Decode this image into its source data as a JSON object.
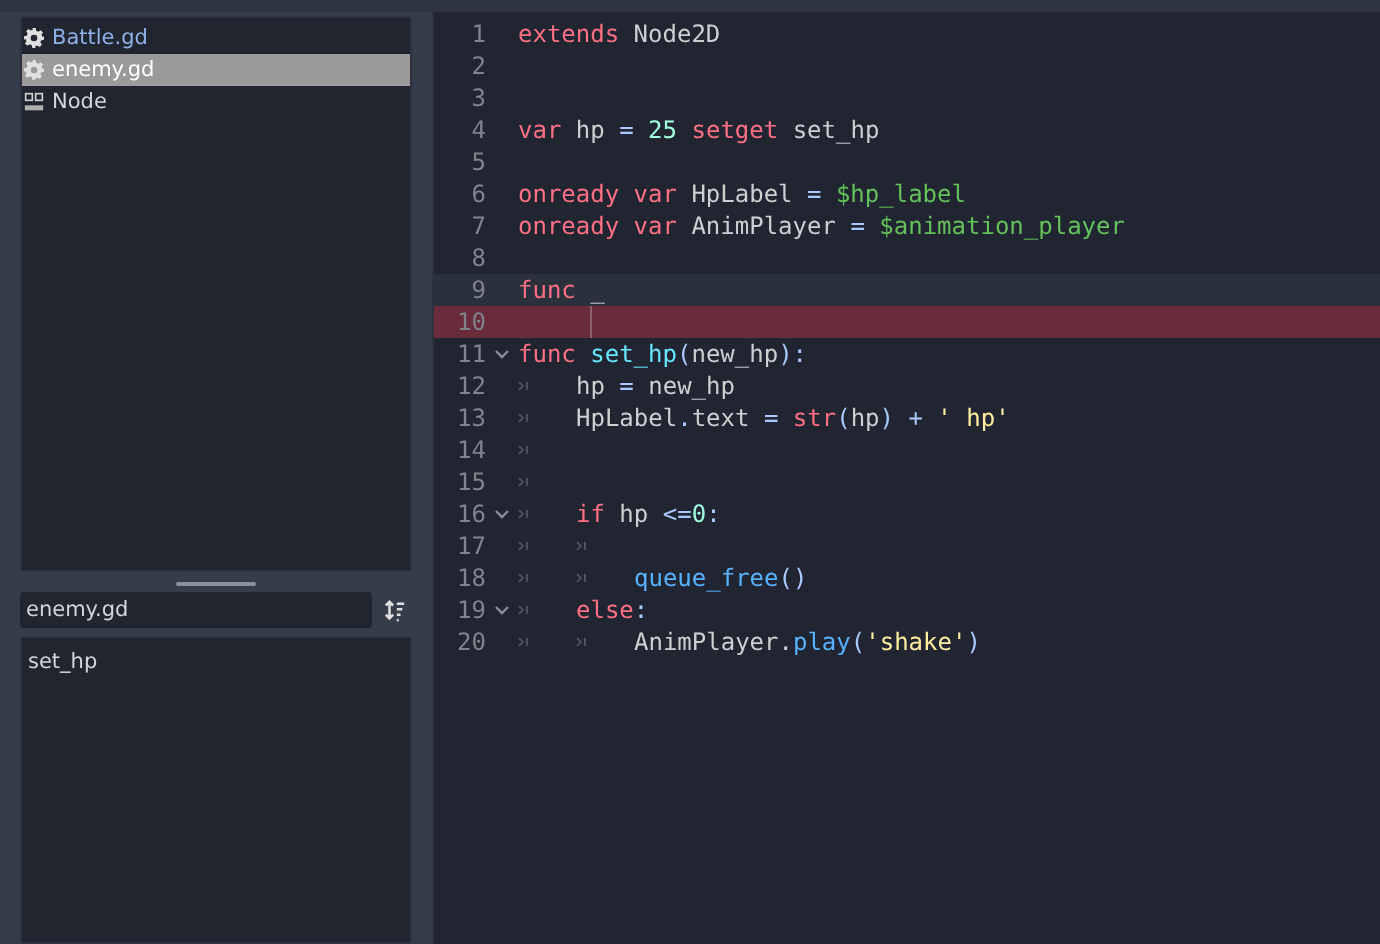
{
  "scripts": [
    {
      "label": "Battle.gd",
      "kind": "script",
      "selected": false,
      "color": "#8fb0e8"
    },
    {
      "label": "enemy.gd",
      "kind": "script",
      "selected": true,
      "color": "#ffffff"
    },
    {
      "label": "Node",
      "kind": "doc",
      "selected": false,
      "color": "#d4d6da"
    }
  ],
  "filter": {
    "value": "enemy.gd"
  },
  "methods": [
    {
      "label": "set_hp",
      "selected": false
    }
  ],
  "lines": [
    {
      "number": "1",
      "kind": "normal",
      "fold": false,
      "cursor": false,
      "tokens": [
        {
          "kind": "keyword",
          "text": "extends"
        },
        {
          "kind": "plain",
          "text": " Node2D"
        }
      ]
    },
    {
      "number": "2",
      "kind": "normal",
      "fold": false,
      "cursor": false
    },
    {
      "number": "3",
      "kind": "normal",
      "fold": false,
      "cursor": false
    },
    {
      "number": "4",
      "kind": "normal",
      "fold": false,
      "cursor": false,
      "tokens": [
        {
          "kind": "keyword",
          "text": "var"
        },
        {
          "kind": "plain",
          "text": " hp"
        },
        {
          "kind": "symbol",
          "text": " ="
        },
        {
          "kind": "number",
          "text": " 25"
        },
        {
          "kind": "keyword",
          "text": " setget"
        },
        {
          "kind": "plain",
          "text": " set_hp"
        }
      ]
    },
    {
      "number": "5",
      "kind": "normal",
      "fold": false,
      "cursor": false
    },
    {
      "number": "6",
      "kind": "normal",
      "fold": false,
      "cursor": false,
      "tokens": [
        {
          "kind": "keyword",
          "text": "onready var"
        },
        {
          "kind": "plain",
          "text": " HpLabel"
        },
        {
          "kind": "symbol",
          "text": " ="
        },
        {
          "kind": "node_path",
          "text": " $hp_label"
        }
      ]
    },
    {
      "number": "7",
      "kind": "normal",
      "fold": false,
      "cursor": false,
      "tokens": [
        {
          "kind": "keyword",
          "text": "onready var"
        },
        {
          "kind": "plain",
          "text": " AnimPlayer"
        },
        {
          "kind": "symbol",
          "text": " ="
        },
        {
          "kind": "node_path",
          "text": " $animation_player"
        }
      ]
    },
    {
      "number": "8",
      "kind": "normal",
      "fold": false,
      "cursor": false
    },
    {
      "number": "9",
      "kind": "current",
      "fold": false,
      "cursor": false,
      "tokens": [
        {
          "kind": "keyword",
          "text": "func"
        },
        {
          "kind": "plain",
          "text": " _"
        }
      ]
    },
    {
      "number": "10",
      "kind": "error",
      "fold": false,
      "cursor": true
    },
    {
      "number": "11",
      "kind": "normal",
      "fold": true,
      "cursor": false,
      "tokens": [
        {
          "kind": "keyword",
          "text": "func"
        },
        {
          "kind": "function",
          "text": " set_hp"
        },
        {
          "kind": "symbol",
          "text": "("
        },
        {
          "kind": "plain",
          "text": "new_hp"
        },
        {
          "kind": "symbol",
          "text": "):"
        }
      ]
    },
    {
      "number": "12",
      "kind": "normal",
      "fold": false,
      "cursor": false,
      "tokens": [
        {
          "kind": "tab"
        },
        {
          "kind": "plain",
          "text": "hp"
        },
        {
          "kind": "symbol",
          "text": " ="
        },
        {
          "kind": "plain",
          "text": " new_hp"
        }
      ]
    },
    {
      "number": "13",
      "kind": "normal",
      "fold": false,
      "cursor": false,
      "tokens": [
        {
          "kind": "tab"
        },
        {
          "kind": "plain",
          "text": "HpLabel"
        },
        {
          "kind": "symbol",
          "text": "."
        },
        {
          "kind": "plain",
          "text": "text"
        },
        {
          "kind": "symbol",
          "text": " ="
        },
        {
          "kind": "keyword",
          "text": " str"
        },
        {
          "kind": "symbol",
          "text": "("
        },
        {
          "kind": "plain",
          "text": "hp"
        },
        {
          "kind": "symbol",
          "text": ") +"
        },
        {
          "kind": "string",
          "text": " ' hp'"
        }
      ]
    },
    {
      "number": "14",
      "kind": "normal",
      "fold": false,
      "cursor": false,
      "tokens": [
        {
          "kind": "tab"
        }
      ]
    },
    {
      "number": "15",
      "kind": "normal",
      "fold": false,
      "cursor": false,
      "tokens": [
        {
          "kind": "tab"
        }
      ]
    },
    {
      "number": "16",
      "kind": "normal",
      "fold": true,
      "cursor": false,
      "tokens": [
        {
          "kind": "tab"
        },
        {
          "kind": "keyword",
          "text": "if"
        },
        {
          "kind": "plain",
          "text": " hp"
        },
        {
          "kind": "symbol",
          "text": " <="
        },
        {
          "kind": "number",
          "text": "0"
        },
        {
          "kind": "symbol",
          "text": ":"
        }
      ]
    },
    {
      "number": "17",
      "kind": "normal",
      "fold": false,
      "cursor": false,
      "tokens": [
        {
          "kind": "tab"
        },
        {
          "kind": "tab"
        }
      ]
    },
    {
      "number": "18",
      "kind": "normal",
      "fold": false,
      "cursor": false,
      "tokens": [
        {
          "kind": "tab"
        },
        {
          "kind": "tab"
        },
        {
          "kind": "call",
          "text": "queue_free"
        },
        {
          "kind": "symbol",
          "text": "()"
        }
      ]
    },
    {
      "number": "19",
      "kind": "normal",
      "fold": true,
      "cursor": false,
      "tokens": [
        {
          "kind": "tab"
        },
        {
          "kind": "keyword",
          "text": "else"
        },
        {
          "kind": "symbol",
          "text": ":"
        }
      ]
    },
    {
      "number": "20",
      "kind": "normal",
      "fold": false,
      "cursor": false,
      "tokens": [
        {
          "kind": "tab"
        },
        {
          "kind": "tab"
        },
        {
          "kind": "plain",
          "text": "AnimPlayer."
        },
        {
          "kind": "call",
          "text": "play"
        },
        {
          "kind": "symbol",
          "text": "("
        },
        {
          "kind": "string",
          "text": "'shake'"
        },
        {
          "kind": "symbol",
          "text": ")"
        }
      ]
    }
  ]
}
